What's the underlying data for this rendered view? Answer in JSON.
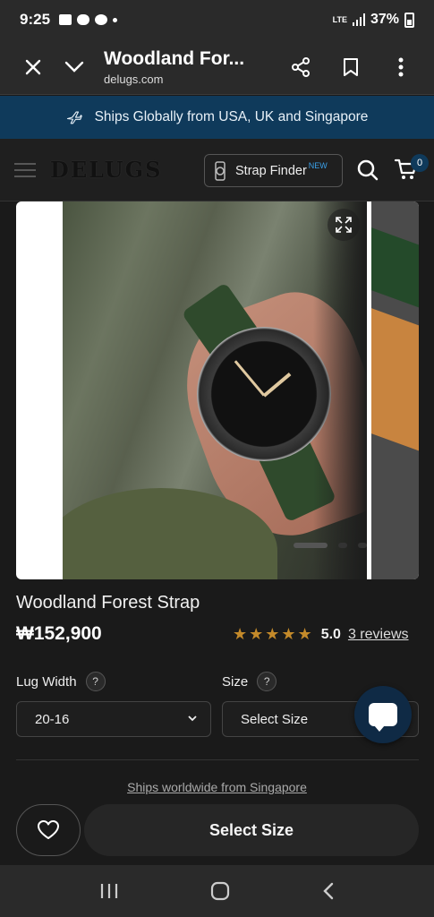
{
  "status": {
    "time": "9:25",
    "network": "LTE",
    "battery": "37%"
  },
  "browser": {
    "title": "Woodland For...",
    "url": "delugs.com"
  },
  "announcement": {
    "text": "Ships Globally from USA, UK and Singapore"
  },
  "header": {
    "logo": "DELUGS",
    "strap_finder": "Strap Finder",
    "strap_finder_badge": "NEW",
    "cart_count": "0"
  },
  "product": {
    "name": "Woodland Forest Strap",
    "price": "₩152,900",
    "stars": "★★★★★",
    "rating": "5.0",
    "reviews": "3 reviews"
  },
  "options": {
    "lug_width_label": "Lug Width",
    "lug_width_value": "20-16",
    "size_label": "Size",
    "size_value": "Select Size",
    "help": "?"
  },
  "shipping_note": "Ships worldwide from Singapore",
  "actions": {
    "select_size": "Select Size"
  },
  "colors": {
    "accent": "#0f3a5b",
    "star": "#c48a2a",
    "background": "#1a1a1a"
  }
}
